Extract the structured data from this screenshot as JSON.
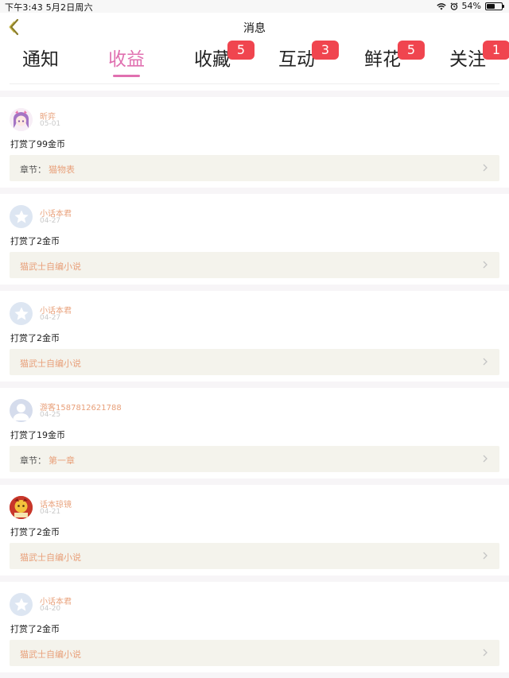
{
  "status_bar": {
    "time_date": "下午3:43  5月2日周六",
    "battery_percent": "54%",
    "battery_level": 0.54
  },
  "nav": {
    "title": "消息",
    "back_icon": "chevron-left-icon"
  },
  "tabs": [
    {
      "label": "通知",
      "badge": ""
    },
    {
      "label": "收益",
      "badge": "",
      "active": true
    },
    {
      "label": "收藏",
      "badge": "5"
    },
    {
      "label": "互动",
      "badge": "3"
    },
    {
      "label": "鲜花",
      "badge": "5"
    },
    {
      "label": "关注",
      "badge": "1"
    }
  ],
  "colors": {
    "accent": "#e070b0",
    "badge": "#f0454f",
    "username": "#e8a07a",
    "link_box": "#f4f3ec"
  },
  "feed": [
    {
      "avatar": "girl-avatar",
      "username": "昕弈",
      "date": "05-01",
      "action": "打赏了99金币",
      "link_prefix": "章节：",
      "link_title": "猫物表"
    },
    {
      "avatar": "star-avatar",
      "username": "小话本君",
      "date": "04-27",
      "action": "打赏了2金币",
      "link_prefix": "",
      "link_title": "猫武士自编小说"
    },
    {
      "avatar": "star-avatar",
      "username": "小话本君",
      "date": "04-27",
      "action": "打赏了2金币",
      "link_prefix": "",
      "link_title": "猫武士自编小说"
    },
    {
      "avatar": "person-avatar",
      "username": "游客1587812621788",
      "date": "04-25",
      "action": "打赏了19金币",
      "link_prefix": "章节：",
      "link_title": "第一章"
    },
    {
      "avatar": "mascot-avatar",
      "username": "话本琼镜",
      "date": "04-21",
      "action": "打赏了2金币",
      "link_prefix": "",
      "link_title": "猫武士自编小说"
    },
    {
      "avatar": "star-avatar",
      "username": "小话本君",
      "date": "04-20",
      "action": "打赏了2金币",
      "link_prefix": "",
      "link_title": "猫武士自编小说"
    }
  ]
}
